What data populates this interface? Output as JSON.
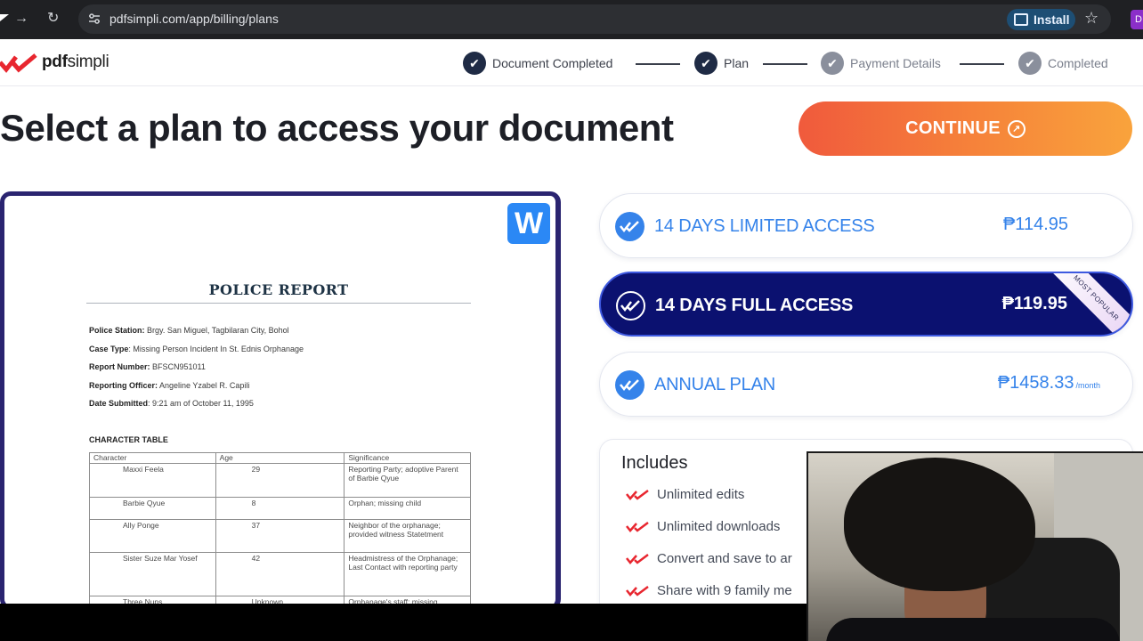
{
  "browser": {
    "url": "pdfsimpli.com/app/billing/plans",
    "install_label": "Install",
    "profile_initial": "D"
  },
  "brand": {
    "name_part1": "pdf",
    "name_part2": "simpli",
    "colors": {
      "logo_red": "#e8262f",
      "navy": "#0b1170",
      "accent_blue": "#3583ea",
      "cta_start": "#f05a3c",
      "cta_end": "#f9a33c"
    }
  },
  "progress": {
    "steps": [
      {
        "label": "Document Completed",
        "state": "done"
      },
      {
        "label": "Plan",
        "state": "current"
      },
      {
        "label": "Payment Details",
        "state": "pending"
      },
      {
        "label": "Completed",
        "state": "pending"
      }
    ]
  },
  "page": {
    "title": "Select a plan to access your document",
    "continue_label": "CONTINUE"
  },
  "document": {
    "badge": "W",
    "title": "POLICE REPORT",
    "fields": [
      {
        "label": "Police Station:",
        "value": " Brgy. San Miguel,  Tagbilaran City, Bohol"
      },
      {
        "label": "Case Type",
        "value": ": Missing Person Incident In St. Ednis Orphanage"
      },
      {
        "label": "Report Number:",
        "value": " BFSCN951011"
      },
      {
        "label": "Reporting Officer:",
        "value": " Angeline Yzabel R. Capili"
      },
      {
        "label": "Date Submitted",
        "value": ": 9:21 am of October 11, 1995"
      }
    ],
    "section_title": "CHARACTER TABLE",
    "table": {
      "headers": [
        "Character",
        "Age",
        "Significance"
      ],
      "rows": [
        [
          "Maxxi Feela",
          "29",
          "Reporting Party; adoptive Parent of Barbie Qyue"
        ],
        [
          "Barbie Qyue",
          "8",
          "Orphan; missing child"
        ],
        [
          "Ally Ponge",
          "37",
          "Neighbor of the orphanage; provided witness Statetment"
        ],
        [
          "Sister Suze Mar Yosef",
          "42",
          "Headmistress of the Orphanage; Last Contact with reporting party"
        ],
        [
          "Three Nuns",
          "Unknown",
          "Orphanage's staff; missing"
        ]
      ]
    }
  },
  "plans": [
    {
      "name": "14 DAYS LIMITED ACCESS",
      "price": "₱114.95",
      "per": "",
      "selected": false
    },
    {
      "name": "14 DAYS FULL ACCESS",
      "price": "₱119.95",
      "per": "",
      "selected": true,
      "ribbon": "MOST POPULAR"
    },
    {
      "name": "ANNUAL PLAN",
      "price": "₱1458.33",
      "per": "/month",
      "selected": false
    }
  ],
  "includes": {
    "title": "Includes",
    "items": [
      "Unlimited edits",
      "Unlimited downloads",
      "Convert and save to ar",
      "Share with 9 family me"
    ]
  }
}
